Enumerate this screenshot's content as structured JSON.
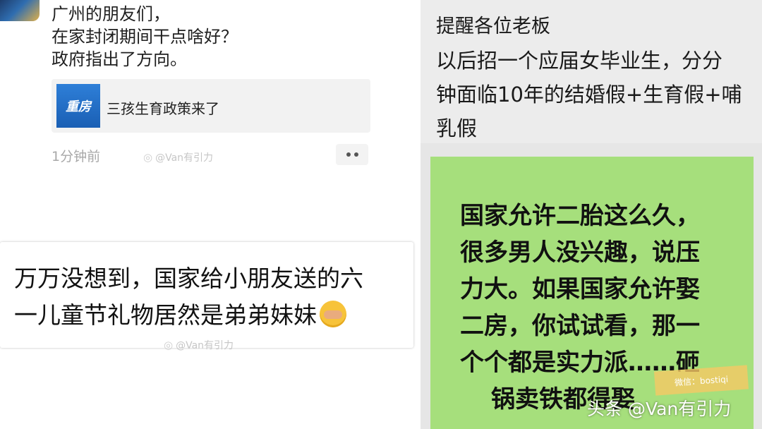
{
  "top_post": {
    "lines": [
      "广州的朋友们，",
      "在家封闭期间干点啥好？",
      "政府指出了方向。"
    ],
    "link_card": {
      "thumb_text": "重房",
      "title": "三孩生育政策来了"
    },
    "time": "1分钟前",
    "watermark": "@Van有引力"
  },
  "comment": {
    "lines": [
      "万万没想到，国家给小朋友送的六",
      "一儿童节礼物居然是弟弟妹妹"
    ],
    "watermark": "@Van有引力"
  },
  "notice": {
    "lines": [
      "提醒各位老板",
      "以后招一个应届女毕业生，分分",
      "钟面临10年的结婚假+生育假+哺",
      "乳假"
    ]
  },
  "poster": {
    "lines": [
      "国家允许二胎这么久，",
      "很多男人没兴趣，说压",
      "力大。如果国家允许娶",
      "二房，你试试看，那一",
      "个个都是实力派……砸",
      "锅卖铁都得娶"
    ],
    "stamp": "微信：bostiqi"
  },
  "source_watermark": "头条 @Van有引力",
  "colors": {
    "poster_green": "#a6df7c",
    "link_thumb_blue": "#2e7fd8",
    "notice_bg": "#ececec"
  }
}
